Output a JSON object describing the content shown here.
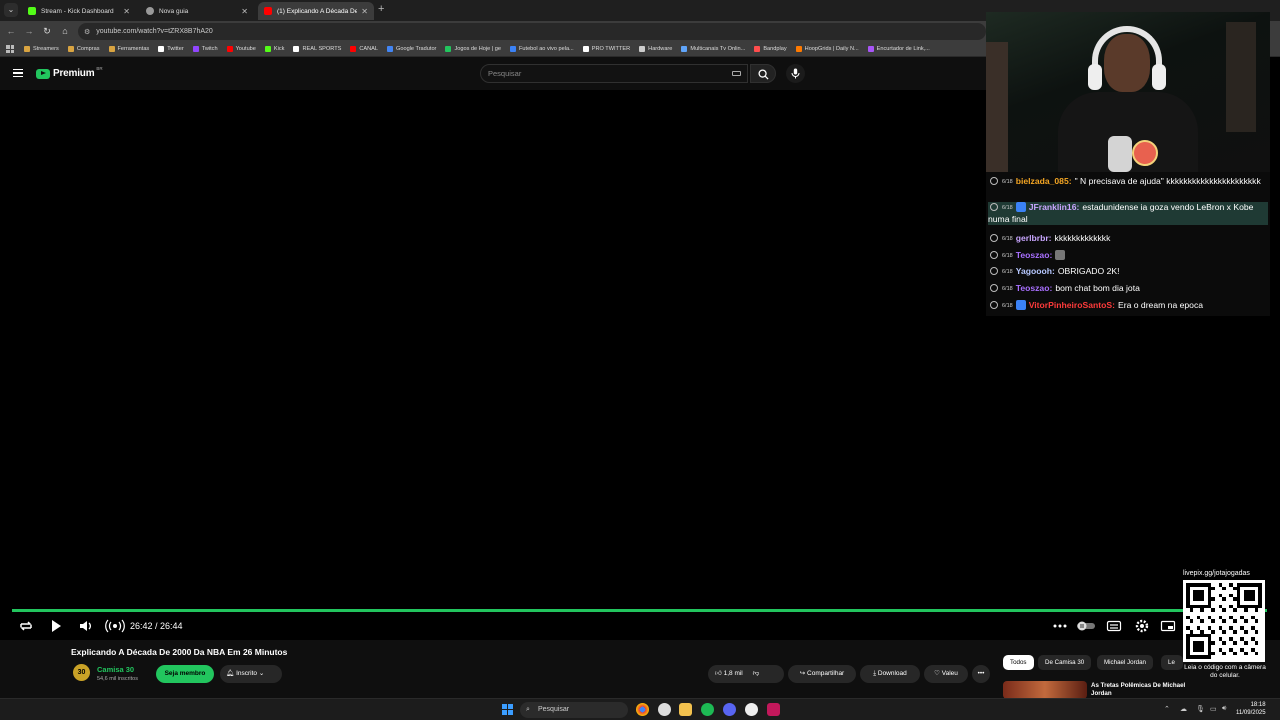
{
  "browser": {
    "tabs": [
      {
        "label": "Stream - Kick Dashboard",
        "color": "#53fc18"
      },
      {
        "label": "Nova guia",
        "color": "#cccccc"
      },
      {
        "label": "(1) Explicando A Década De 20",
        "color": "#ff0000"
      }
    ],
    "url": "youtube.com/watch?v=tZRX8B7hA20",
    "bookmarks": [
      "Streamers",
      "Compras",
      "Ferramentas",
      "Twitter",
      "Twitch",
      "Youtube",
      "Kick",
      "REAL SPORTS",
      "CANAL",
      "Google Tradutor",
      "Jogos de Hoje | ge",
      "Futebol ao vivo pela...",
      "PRO TWITTER",
      "Hardware",
      "Multicanais Tv Onlin...",
      "Bandplay",
      "HoopGrids | Daily N...",
      "Encurtador de Link,..."
    ]
  },
  "youtube": {
    "logo_text": "Premium",
    "region": "BR",
    "search_placeholder": "Pesquisar",
    "accent": "#22c55e",
    "player": {
      "time": "26:42 / 26:44",
      "progress": 0.999
    },
    "video_title": "Explicando A Década De 2000 Da NBA Em 26 Minutos",
    "channel": {
      "name": "Camisa 30",
      "subscribers": "54,6 mil inscritos",
      "avatar_text": "30"
    },
    "buttons": {
      "join": "Seja membro",
      "subscribed": "Inscrito",
      "likes": "1,8 mil",
      "share": "Compartilhar",
      "download": "Download",
      "thanks": "Valeu"
    },
    "chips": [
      "Todos",
      "De Camisa 30",
      "Michael Jordan",
      "Le"
    ],
    "recommended_title": "As Tretas Polêmicas De Michael Jordan"
  },
  "chat": [
    {
      "badge": "6/18",
      "user": "bielzada_085:",
      "color": "#f5a623",
      "text": "\" N precisava de ajuda\" kkkkkkkkkkkkkkkkkkkkkk",
      "highlight": false
    },
    {
      "badge": "6/18",
      "user": "JFranklin16:",
      "color": "#c9a6ff",
      "text": "estadunidense ia goza vendo LeBron x Kobe numa final",
      "highlight": true
    },
    {
      "badge": "6/18",
      "user": "gerlbrbr:",
      "color": "#c9a6ff",
      "text": "kkkkkkkkkkkkk",
      "highlight": false
    },
    {
      "badge": "6/18",
      "user": "Teoszao:",
      "color": "#a970ff",
      "text": "",
      "highlight": false
    },
    {
      "badge": "6/18",
      "user": "Yagoooh:",
      "color": "#b7c8ff",
      "text": "OBRIGADO 2K!",
      "highlight": false
    },
    {
      "badge": "6/18",
      "user": "Teoszao:",
      "color": "#a970ff",
      "text": "bom chat bom dia jota",
      "highlight": false
    },
    {
      "badge": "6/18",
      "user": "VitorPinheiroSantoS:",
      "color": "#ff3b3b",
      "text": "Era o dream na epoca",
      "highlight": false
    }
  ],
  "qr": {
    "url": "livepix.gg/jotajogadas",
    "caption": "Leia o código com a câmera do celular."
  },
  "taskbar": {
    "search": "Pesquisar",
    "time": "18:18",
    "date": "11/09/2025"
  }
}
